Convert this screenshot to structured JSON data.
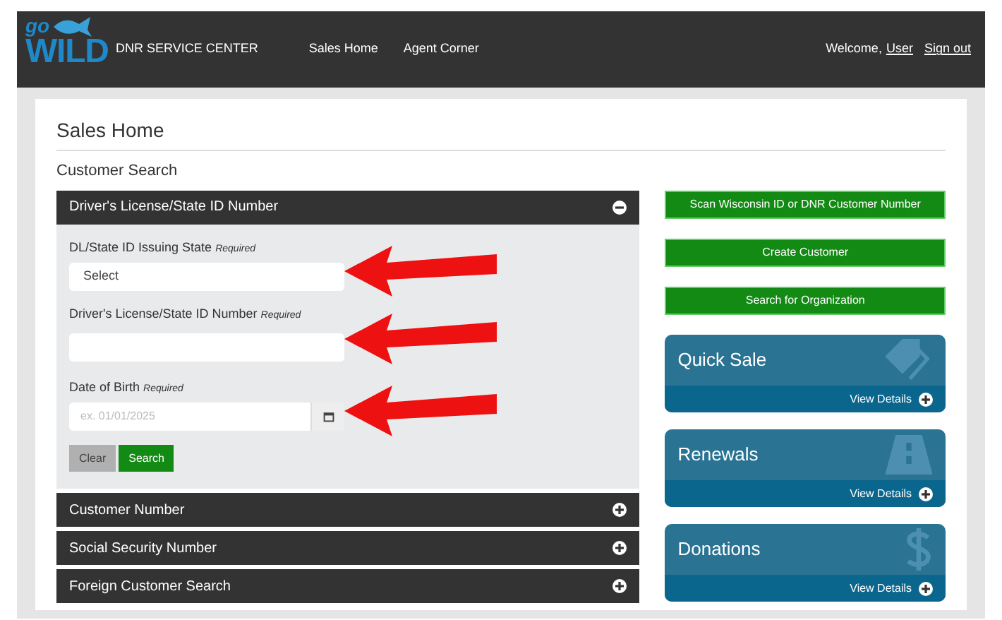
{
  "header": {
    "logo": {
      "top": "go",
      "bottom": "WILD"
    },
    "title": "DNR SERVICE CENTER",
    "nav": [
      "Sales Home",
      "Agent Corner"
    ],
    "welcome": "Welcome,",
    "user": "User",
    "sign_out": "Sign out"
  },
  "page_title": "Sales Home",
  "section_title": "Customer Search",
  "accordion": [
    {
      "title": "Driver's License/State ID Number",
      "expanded": true,
      "fields": [
        {
          "kind": "select",
          "label": "DL/State ID Issuing State",
          "required": "Required",
          "value": "Select",
          "arrow": true
        },
        {
          "kind": "text",
          "label": "Driver's License/State ID Number",
          "required": "Required",
          "arrow": true
        },
        {
          "kind": "date",
          "label": "Date of Birth",
          "required": "Required",
          "placeholder": "ex. 01/01/2025",
          "arrow": true
        }
      ],
      "buttons": [
        {
          "kind": "secondary",
          "label": "Clear"
        },
        {
          "kind": "primary",
          "label": "Search"
        }
      ]
    },
    {
      "title": "Customer Number",
      "expanded": false
    },
    {
      "title": "Social Security Number",
      "expanded": false
    },
    {
      "title": "Foreign Customer Search",
      "expanded": false
    }
  ],
  "actions": [
    "Scan Wisconsin ID or DNR Customer Number",
    "Create Customer",
    "Search for Organization"
  ],
  "tiles": [
    {
      "kind": "tag",
      "title": "Quick Sale",
      "link": "View Details"
    },
    {
      "kind": "road",
      "title": "Renewals",
      "link": "View Details"
    },
    {
      "kind": "dollar",
      "title": "Donations",
      "link": "View Details"
    }
  ]
}
